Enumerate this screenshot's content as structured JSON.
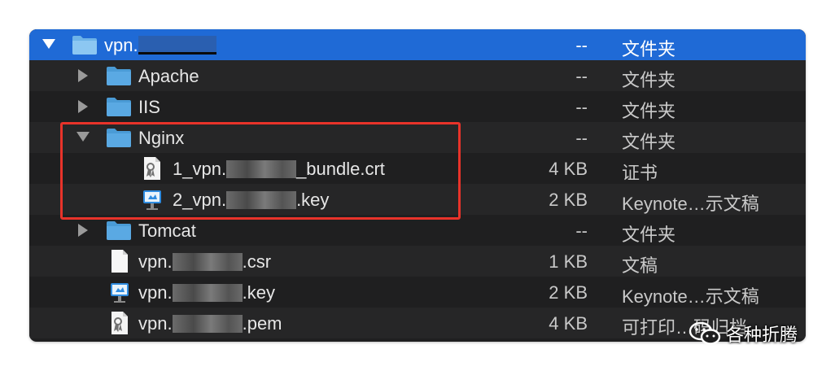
{
  "rows": [
    {
      "name_prefix": "vpn.",
      "name_suffix": "",
      "size": "--",
      "kind": "文件夹"
    },
    {
      "name": "Apache",
      "size": "--",
      "kind": "文件夹"
    },
    {
      "name": "IIS",
      "size": "--",
      "kind": "文件夹"
    },
    {
      "name": "Nginx",
      "size": "--",
      "kind": "文件夹"
    },
    {
      "name_prefix": "1_vpn.",
      "name_suffix": "_bundle.crt",
      "size": "4 KB",
      "kind": "证书"
    },
    {
      "name_prefix": "2_vpn.",
      "name_suffix": ".key",
      "size": "2 KB",
      "kind": "Keynote…示文稿"
    },
    {
      "name": "Tomcat",
      "size": "--",
      "kind": "文件夹"
    },
    {
      "name_prefix": "vpn.",
      "name_suffix": ".csr",
      "size": "1 KB",
      "kind": "文稿"
    },
    {
      "name_prefix": "vpn.",
      "name_suffix": ".key",
      "size": "2 KB",
      "kind": "Keynote…示文稿"
    },
    {
      "name_prefix": "vpn.",
      "name_suffix": ".pem",
      "size": "4 KB",
      "kind": "可打印…码归档"
    }
  ],
  "watermark": {
    "text": "各种折腾"
  },
  "colors": {
    "selection": "#1f6ad6",
    "folder": "#5aa5dd",
    "highlight_box": "#e8332a",
    "panel": "#1f1f20"
  }
}
